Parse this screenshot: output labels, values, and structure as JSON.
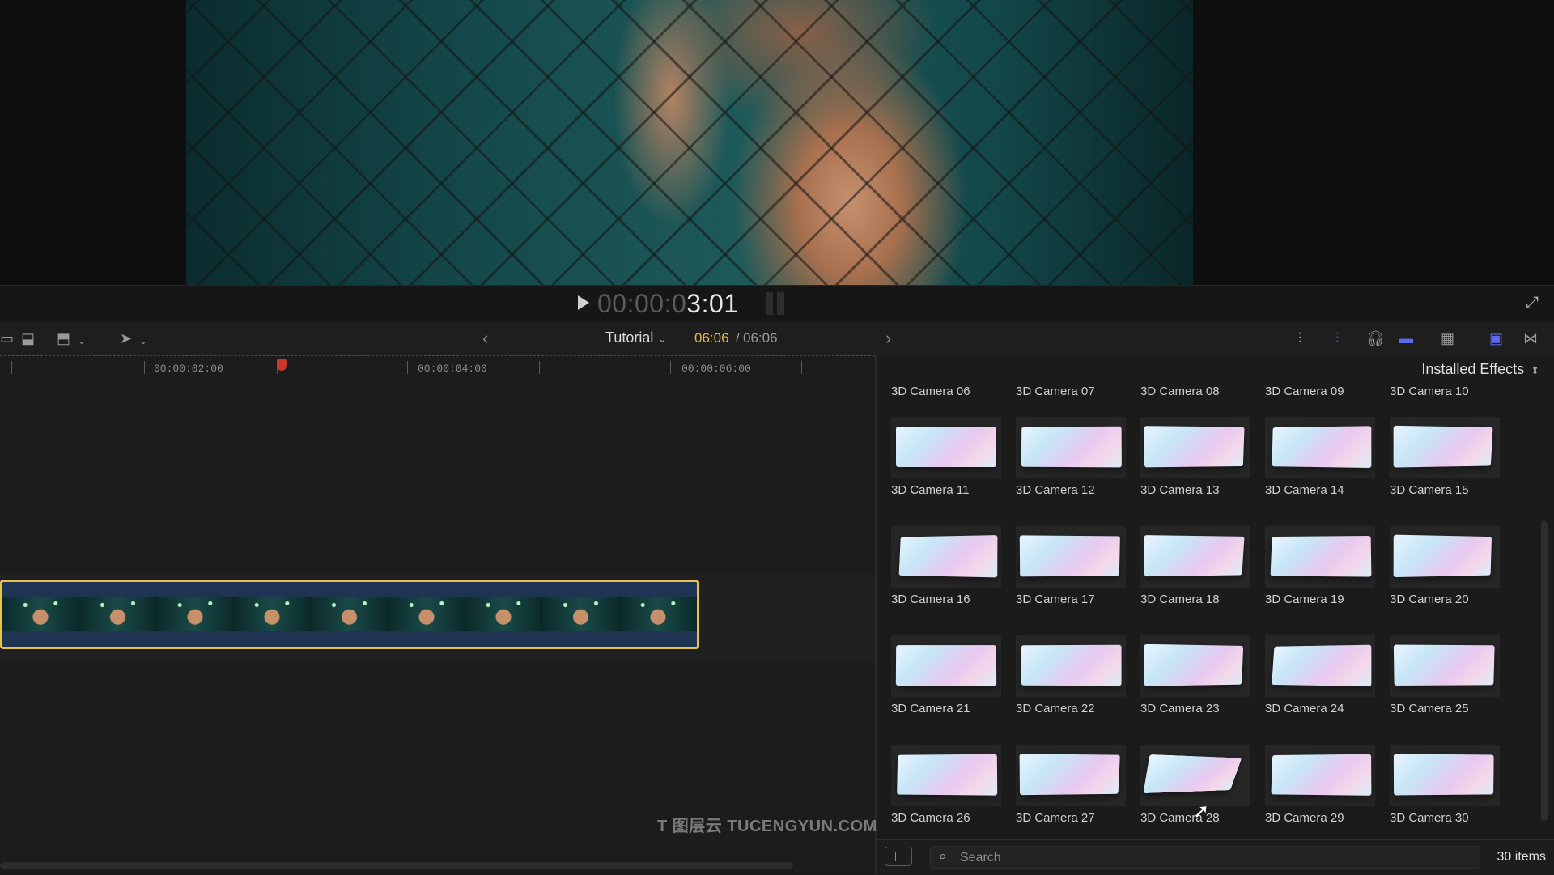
{
  "viewer": {
    "timecode_dim": "00:00:0",
    "timecode_bright": "3:01"
  },
  "toolbar": {
    "project_title": "Tutorial",
    "timecode_current": "06:06",
    "timecode_separator": "/",
    "timecode_total": "06:06",
    "icons": [
      "append-clip-icon",
      "overwrite-clip-icon",
      "select-tool-icon",
      "previous-arrow-icon",
      "next-arrow-icon",
      "skimming-icon",
      "audio-skimming-icon",
      "headphones-icon",
      "snapping-icon",
      "clip-appearance-icon",
      "effects-browser-icon",
      "transitions-browser-icon"
    ]
  },
  "timeline": {
    "ruler_labels": [
      "00:00:02:00",
      "00:00:04:00",
      "00:00:06:00"
    ],
    "frame_count": 9
  },
  "browser": {
    "category": "Installed Effects",
    "first_row_labels": [
      "3D Camera 06",
      "3D Camera 07",
      "3D Camera 08",
      "3D Camera 09",
      "3D Camera 10"
    ],
    "effects": [
      "3D Camera 11",
      "3D Camera 12",
      "3D Camera 13",
      "3D Camera 14",
      "3D Camera 15",
      "3D Camera 16",
      "3D Camera 17",
      "3D Camera 18",
      "3D Camera 19",
      "3D Camera 20",
      "3D Camera 21",
      "3D Camera 22",
      "3D Camera 23",
      "3D Camera 24",
      "3D Camera 25",
      "3D Camera 26",
      "3D Camera 27",
      "3D Camera 28",
      "3D Camera 29",
      "3D Camera 30"
    ],
    "search_placeholder": "Search",
    "item_count": "30 items"
  },
  "watermark": "T 图层云 TUCENGYUN.COM",
  "colors": {
    "accent_timecode": "#e5b94a",
    "playhead": "#c8382e",
    "clip_border": "#e8c34a",
    "clip_fill": "#1f3352"
  }
}
